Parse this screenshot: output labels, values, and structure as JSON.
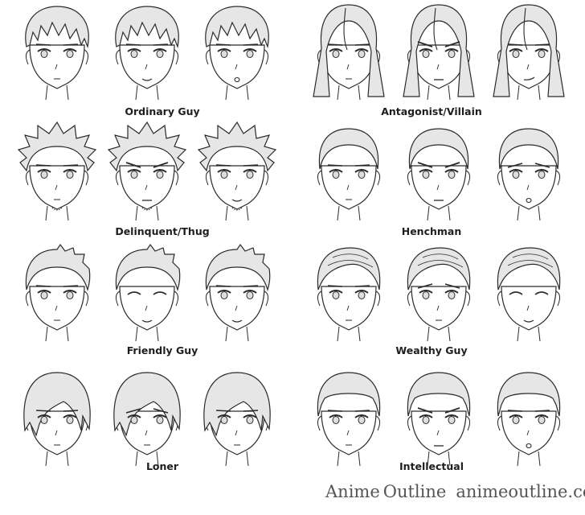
{
  "groups": [
    {
      "label": "Ordinary Guy",
      "hair": "messy",
      "faces": [
        "neutral",
        "smile",
        "surprised"
      ]
    },
    {
      "label": "Antagonist/Villain",
      "hair": "long",
      "faces": [
        "neutral",
        "angry",
        "smirk"
      ]
    },
    {
      "label": "Delinquent/Thug",
      "hair": "spiky",
      "faces": [
        "neutral",
        "angry",
        "grin"
      ]
    },
    {
      "label": "Henchman",
      "hair": "buzz",
      "faces": [
        "neutral",
        "angry",
        "scared"
      ]
    },
    {
      "label": "Friendly Guy",
      "hair": "short",
      "faces": [
        "neutral",
        "happy-closed",
        "smile"
      ]
    },
    {
      "label": "Wealthy Guy",
      "hair": "slicked",
      "faces": [
        "neutral",
        "sad",
        "happy-closed"
      ]
    },
    {
      "label": "Loner",
      "hair": "covered",
      "faces": [
        "neutral",
        "sad",
        "tired"
      ]
    },
    {
      "label": "Intellectual",
      "hair": "neat",
      "faces": [
        "neutral",
        "angry",
        "surprised"
      ]
    }
  ],
  "watermark": {
    "brand_part1": "Anime",
    "brand_part2": "Outline",
    "url": "animeoutline.com"
  },
  "colors": {
    "hair_fill": "#e6e6e6",
    "line": "#2a2a2a",
    "watermark": "#555555"
  }
}
